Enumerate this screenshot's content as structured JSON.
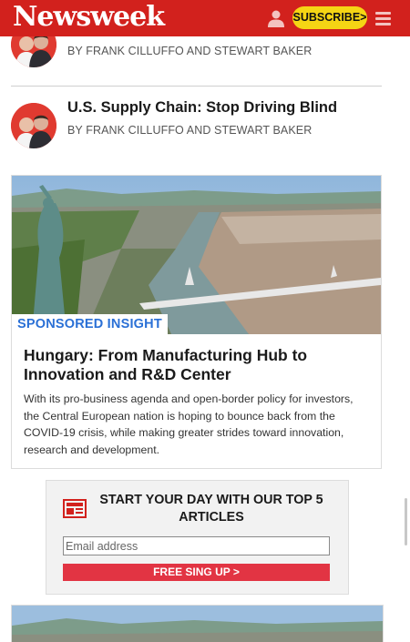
{
  "header": {
    "logo": "Newsweek",
    "subscribe_label": "SUBSCRIBE>"
  },
  "articles": [
    {
      "byline": "BY FRANK CILLUFFO AND STEWART BAKER"
    },
    {
      "title": "U.S. Supply Chain: Stop Driving Blind",
      "byline": "BY FRANK CILLUFFO AND STEWART BAKER"
    }
  ],
  "sponsored": {
    "tag": "SPONSORED INSIGHT",
    "title": "Hungary: From Manufacturing Hub to Innovation and R&D Center",
    "text": "With its pro-business agenda and open-border policy for investors, the Central European nation is hoping to bounce back from the COVID-19 crisis, while making greater strides toward innovation, research and development."
  },
  "newsletter": {
    "heading": "START YOUR DAY WITH OUR TOP 5 ARTICLES",
    "email_placeholder": "Email address",
    "button_label": "FREE SING UP >"
  },
  "colors": {
    "brand_red": "#d2211d",
    "subscribe_yellow": "#f5d514",
    "sponsored_blue": "#2a70d6",
    "signup_red": "#e23443"
  }
}
